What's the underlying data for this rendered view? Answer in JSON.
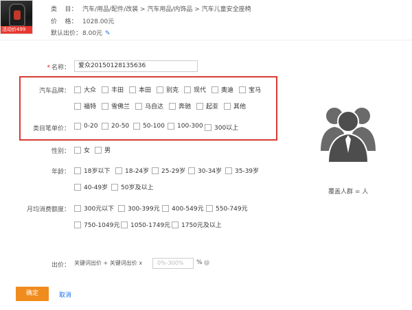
{
  "product": {
    "promo_text": "活动价499",
    "category_label": "类",
    "category_colon": "目：",
    "category_path": "汽车/用品/配件/改装 > 汽车用品/内饰品 > 汽车儿童安全座椅",
    "price_label": "价",
    "price_colon": "格：",
    "price": "1028.00元",
    "default_bid_label": "默认出价：",
    "default_bid": "8.00元"
  },
  "form": {
    "name_label": "名称：",
    "name_value": "爱众20150128135636",
    "brand_label": "汽车品牌：",
    "brands": [
      "大众",
      "丰田",
      "本田",
      "别克",
      "现代",
      "奥迪",
      "宝马",
      "福特",
      "雪佛兰",
      "马自达",
      "奔驰",
      "起亚",
      "其他"
    ],
    "price_range_label": "类目笔单价：",
    "price_ranges": [
      "0-20",
      "20-50",
      "50-100",
      "100-300",
      "300以上"
    ],
    "gender_label": "性别：",
    "genders": [
      "女",
      "男"
    ],
    "age_label": "年龄：",
    "ages": [
      "18岁以下",
      "18-24岁",
      "25-29岁",
      "30-34岁",
      "35-39岁",
      "40-49岁",
      "50岁及以上"
    ],
    "spend_label": "月均消费额度：",
    "spends": [
      "300元以下",
      "300-399元",
      "400-549元",
      "550-749元",
      "750-1049元",
      "1050-1749元",
      "1750元及以上"
    ],
    "bid_label": "出价：",
    "bid_formula": "关键词出价 + 关键词出价 x",
    "bid_placeholder": "0%-300%",
    "bid_unit": "%"
  },
  "audience": {
    "cover_text": "覆盖人群 = 人"
  },
  "buttons": {
    "confirm": "确定",
    "cancel": "取消"
  },
  "colors": {
    "highlight_box": "#d73a33",
    "confirm_button": "#f08c1e",
    "link": "#1a73e8",
    "avatar": "#555555"
  },
  "icons": {
    "edit": "pencil-icon",
    "help": "question-icon",
    "audience": "people-group-icon"
  }
}
